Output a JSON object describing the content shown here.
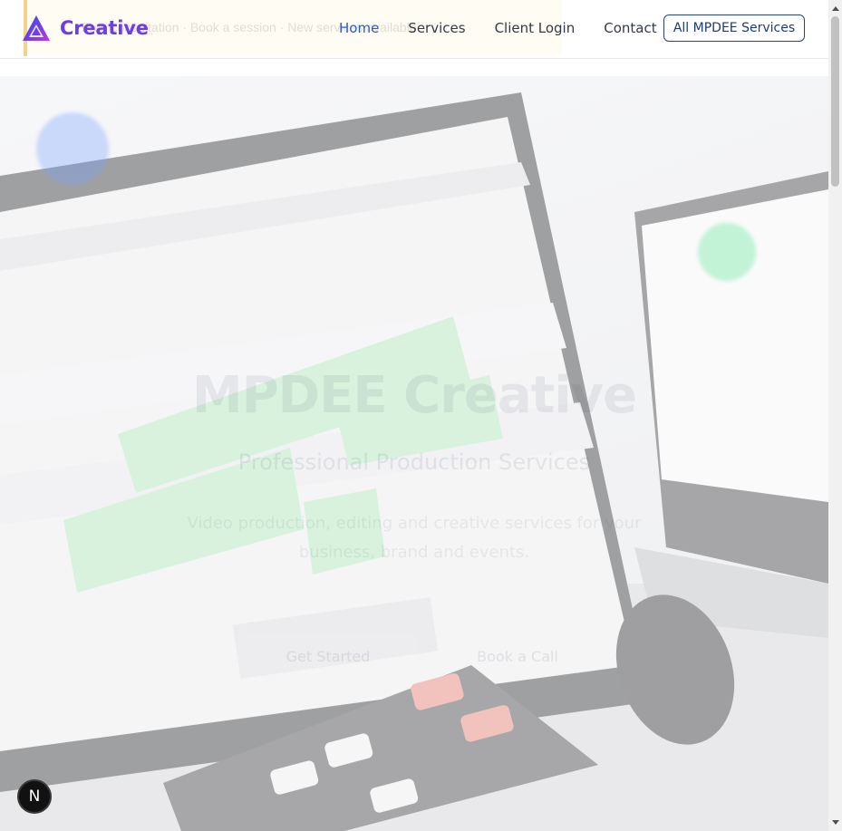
{
  "header": {
    "announcement": "Free consultation · Book a session · New services available",
    "logo_text": "Creative",
    "nav": [
      {
        "label": "Home",
        "active": true
      },
      {
        "label": "Services",
        "active": false
      },
      {
        "label": "Client Login",
        "active": false
      },
      {
        "label": "Contact",
        "active": false
      }
    ],
    "cta_label": "All MPDEE Services"
  },
  "hero": {
    "title": "MPDEE Creative",
    "subtitle": "Professional Production Services",
    "description": "Video production, editing and creative services for your business, brand and events.",
    "primary_button": "Get Started",
    "secondary_button": "Book a Call"
  },
  "badge": {
    "letter": "N",
    "icon": "nextjs-icon"
  },
  "colors": {
    "brand_purple": "#6d3ee6",
    "nav_active": "#2d5ec9",
    "cta_border": "#25428c"
  }
}
